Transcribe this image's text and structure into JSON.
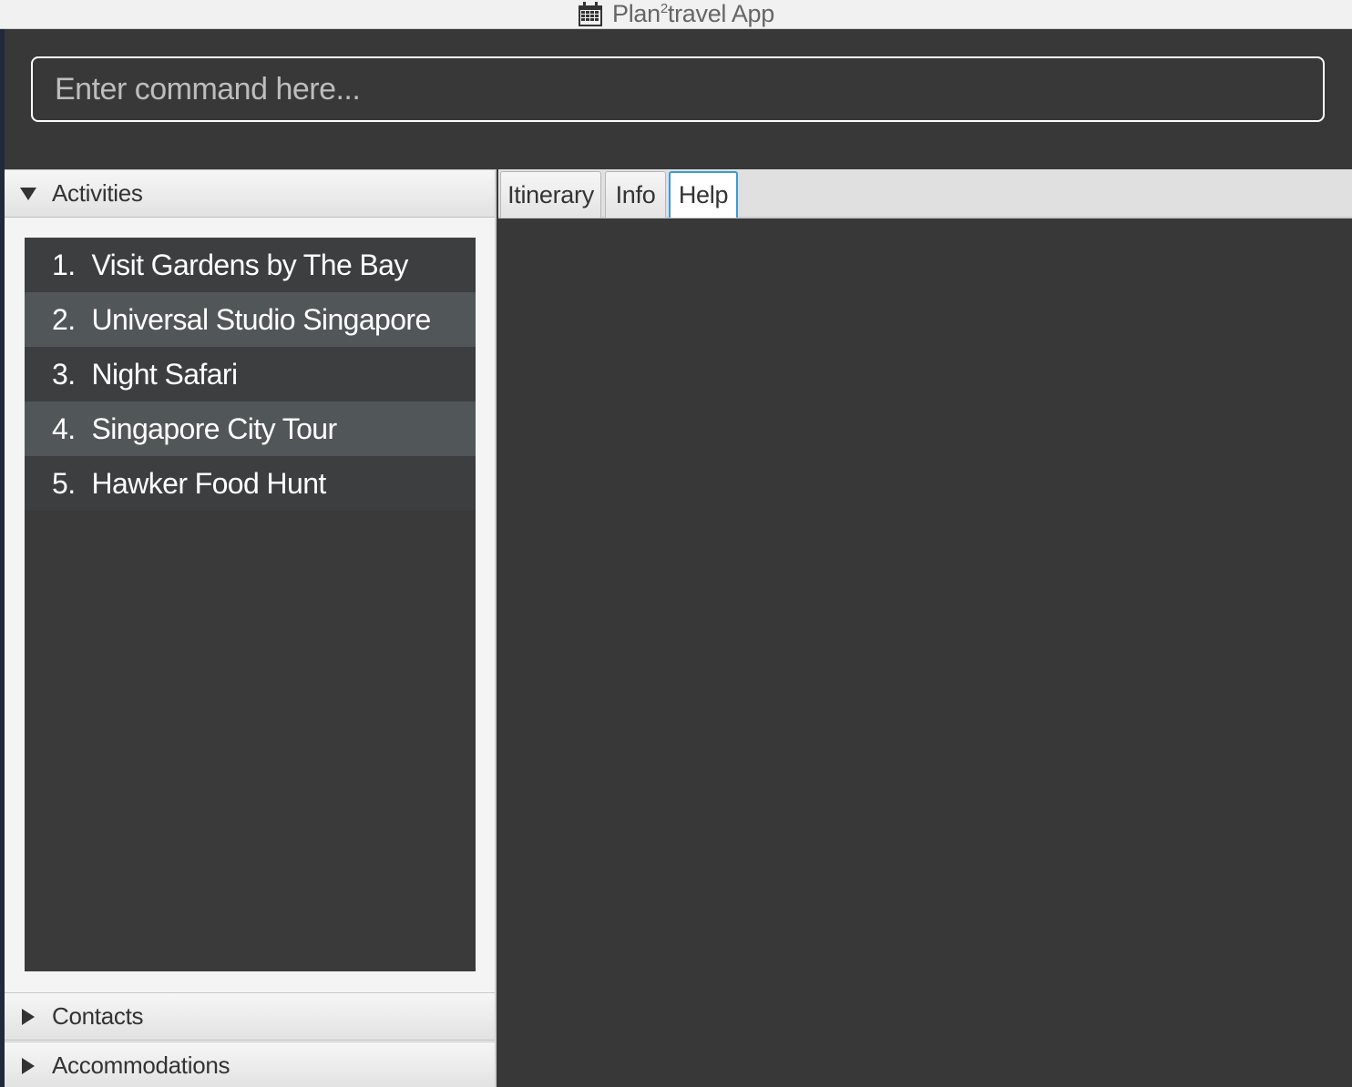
{
  "window": {
    "title_prefix": "Plan",
    "title_sup": "2",
    "title_suffix": "travel App"
  },
  "command": {
    "placeholder": "Enter command here..."
  },
  "sidebar": {
    "sections": [
      {
        "label": "Activities",
        "expanded": true
      },
      {
        "label": "Contacts",
        "expanded": false
      },
      {
        "label": "Accommodations",
        "expanded": false
      }
    ],
    "activities": [
      {
        "num": "1.",
        "name": "Visit Gardens by The Bay"
      },
      {
        "num": "2.",
        "name": "Universal Studio Singapore"
      },
      {
        "num": "3.",
        "name": "Night Safari"
      },
      {
        "num": "4.",
        "name": "Singapore City Tour"
      },
      {
        "num": "5.",
        "name": "Hawker Food Hunt"
      }
    ]
  },
  "tabs": [
    {
      "label": "Itinerary",
      "selected": false
    },
    {
      "label": "Info",
      "selected": false
    },
    {
      "label": "Help",
      "selected": true
    }
  ],
  "colors": {
    "background": "#383838",
    "tab_focus": "#3a9bd6",
    "row_alt": "#515658"
  },
  "icons": {
    "title_icon": "calendar-icon",
    "expanded_arrow": "triangle-down-icon",
    "collapsed_arrow": "triangle-right-icon"
  }
}
